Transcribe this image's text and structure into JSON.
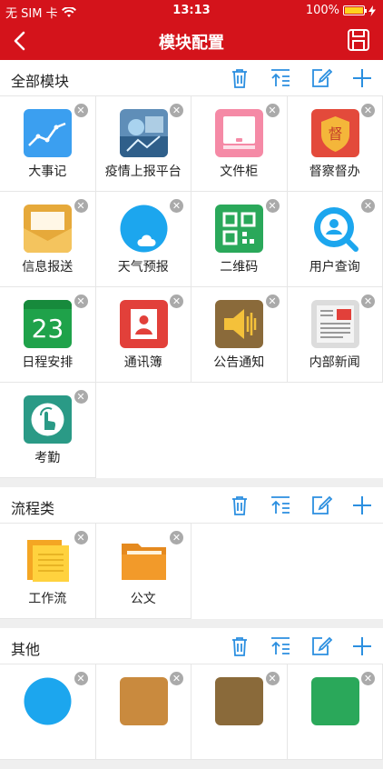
{
  "status_bar": {
    "carrier": "无 SIM 卡",
    "time": "13:13",
    "battery": "100%"
  },
  "nav": {
    "title": "模块配置"
  },
  "sections": [
    {
      "title": "全部模块",
      "modules": [
        "大事记",
        "疫情上报平台",
        "文件柜",
        "督察督办",
        "信息报送",
        "天气预报",
        "二维码",
        "用户查询",
        "日程安排",
        "通讯簿",
        "公告通知",
        "内部新闻",
        "考勤"
      ]
    },
    {
      "title": "流程类",
      "modules": [
        "工作流",
        "公文"
      ]
    },
    {
      "title": "其他",
      "modules": []
    }
  ],
  "calendar_day": "23",
  "supervise_char": "督",
  "colors": {
    "nav_red": "#d4131b",
    "tool_blue": "#2b8fe0",
    "delete_gray": "#aaaaaa"
  }
}
